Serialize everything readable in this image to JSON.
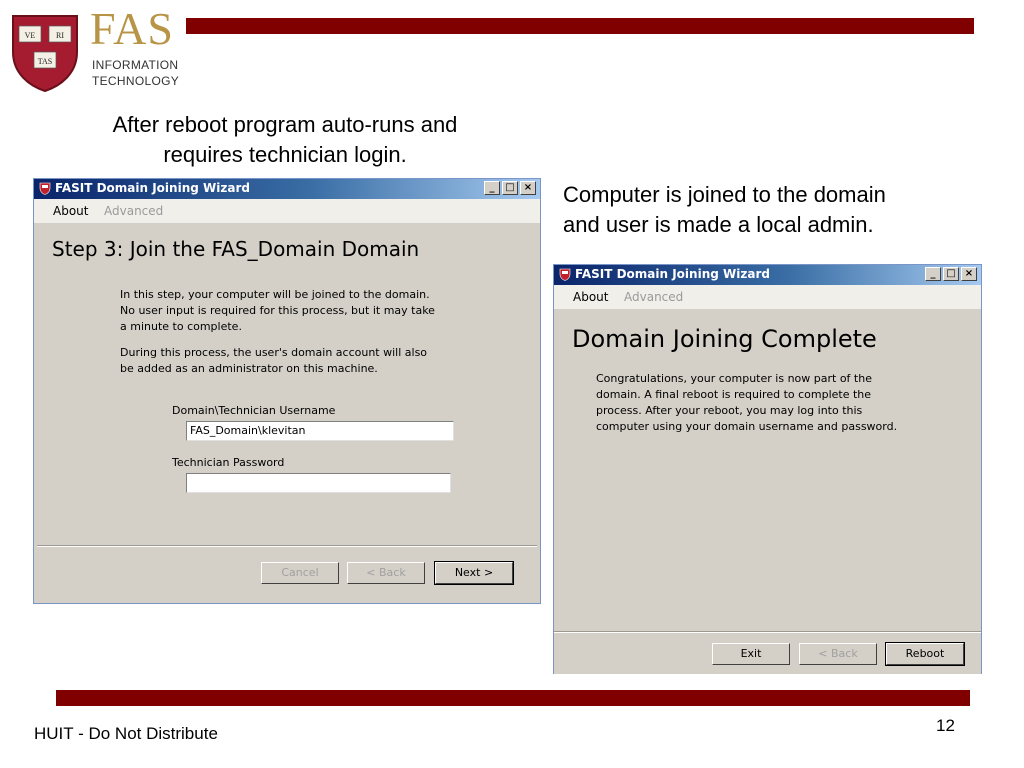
{
  "header": {
    "logo_shield_text": [
      "VE",
      "RI",
      "TAS"
    ],
    "logo_title": "FAS",
    "logo_sub1": "INFORMATION",
    "logo_sub2": "TECHNOLOGY"
  },
  "captions": {
    "left_line1": "After reboot program auto-runs and",
    "left_line2": "requires technician login.",
    "right_line1": "Computer is joined to the domain",
    "right_line2": "and user is made a local admin."
  },
  "window1": {
    "title": "FASIT Domain Joining Wizard",
    "menu_about": "About",
    "menu_advanced": "Advanced",
    "heading": "Step 3: Join the FAS_Domain Domain",
    "para1": [
      "In this step, your computer will be joined to the domain.",
      "No user input is required for this process, but it may take",
      "a minute to complete."
    ],
    "para2": [
      "During this process, the user's domain account will also",
      "be added as an administrator on this machine."
    ],
    "username_label": "Domain\\Technician Username",
    "username_value": "FAS_Domain\\klevitan",
    "password_label": "Technician Password",
    "password_value": "",
    "btn_cancel": "Cancel",
    "btn_back": "< Back",
    "btn_next": "Next >"
  },
  "window2": {
    "title": "FASIT Domain Joining Wizard",
    "menu_about": "About",
    "menu_advanced": "Advanced",
    "heading": "Domain Joining Complete",
    "para": [
      "Congratulations, your computer is now part of the",
      "domain.  A final reboot is required to complete the",
      "process.  After your reboot, you may log into this",
      "computer using your domain username and password."
    ],
    "btn_exit": "Exit",
    "btn_back": "< Back",
    "btn_reboot": "Reboot"
  },
  "footer": {
    "text": "HUIT - Do Not Distribute",
    "page": "12"
  }
}
